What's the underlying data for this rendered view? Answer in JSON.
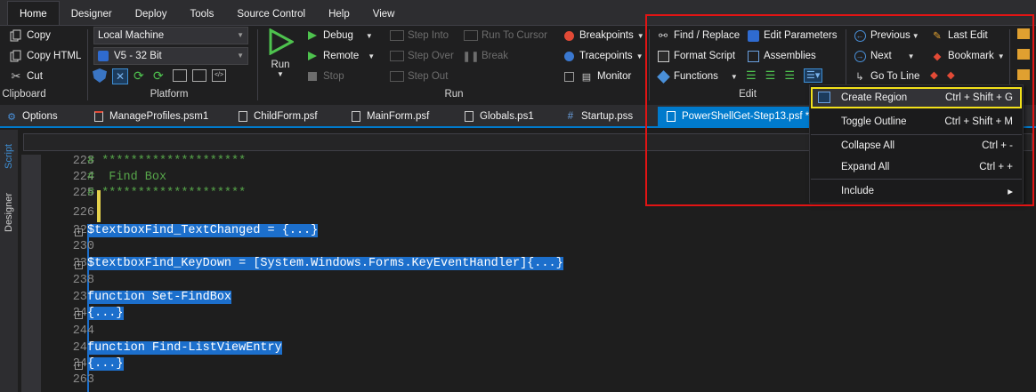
{
  "menu": {
    "tabs": [
      "Home",
      "Designer",
      "Deploy",
      "Tools",
      "Source Control",
      "Help",
      "View"
    ]
  },
  "clipboard": {
    "copy": "Copy",
    "copy_html": "Copy HTML",
    "cut": "Cut",
    "label": "Clipboard"
  },
  "platform": {
    "machine": "Local Machine",
    "version": "V5  -  32 Bit",
    "label": "Platform"
  },
  "run": {
    "run": "Run",
    "debug": "Debug",
    "remote": "Remote",
    "stop": "Stop",
    "step_into": "Step Into",
    "step_over": "Step Over",
    "step_out": "Step Out",
    "run_to_cursor": "Run To Cursor",
    "break": "Break",
    "breakpoints": "Breakpoints",
    "tracepoints": "Tracepoints",
    "monitor": "Monitor",
    "label": "Run"
  },
  "edit": {
    "find_replace": "Find / Replace",
    "format_script": "Format Script",
    "functions": "Functions",
    "edit_parameters": "Edit Parameters",
    "assemblies": "Assemblies",
    "label": "Edit"
  },
  "nav": {
    "previous": "Previous",
    "next": "Next",
    "go_to_line": "Go To Line",
    "last_edit": "Last Edit",
    "bookmark": "Bookmark"
  },
  "file_tabs": [
    "Options",
    "ManageProfiles.psm1",
    "ChildForm.psf",
    "MainForm.psf",
    "Globals.ps1",
    "Startup.pss",
    "PowerShellGet-Step13.psf *"
  ],
  "side_tabs": {
    "script": "Script",
    "designer": "Designer"
  },
  "code_lines": [
    {
      "n": "223",
      "t": "# ********************"
    },
    {
      "n": "224",
      "t": "#  Find Box"
    },
    {
      "n": "225",
      "t": "# ********************"
    },
    {
      "n": "226",
      "t": ""
    },
    {
      "n": "227",
      "t": "$textboxFind_TextChanged = {...}"
    },
    {
      "n": "230",
      "t": ""
    },
    {
      "n": "231",
      "t": "$textboxFind_KeyDown = [System.Windows.Forms.KeyEventHandler]{...}"
    },
    {
      "n": "238",
      "t": ""
    },
    {
      "n": "239",
      "t": "function Set-FindBox"
    },
    {
      "n": "240",
      "t": "{...}"
    },
    {
      "n": "244",
      "t": ""
    },
    {
      "n": "245",
      "t": "function Find-ListViewEntry"
    },
    {
      "n": "246",
      "t": "{...}"
    },
    {
      "n": "263",
      "t": ""
    }
  ],
  "dropdown": [
    {
      "label": "Create Region",
      "shortcut": "Ctrl + Shift + G"
    },
    {
      "label": "Toggle Outline",
      "shortcut": "Ctrl + Shift + M"
    },
    {
      "label": "Collapse All",
      "shortcut": "Ctrl + -"
    },
    {
      "label": "Expand All",
      "shortcut": "Ctrl + +"
    },
    {
      "label": "Include",
      "shortcut": "▸"
    }
  ],
  "colors": {
    "accent": "#007acc",
    "selection": "#1c6fcc",
    "highlight_box": "#e21414",
    "menu_highlight": "#f3e11a",
    "comment": "#57a64a"
  }
}
